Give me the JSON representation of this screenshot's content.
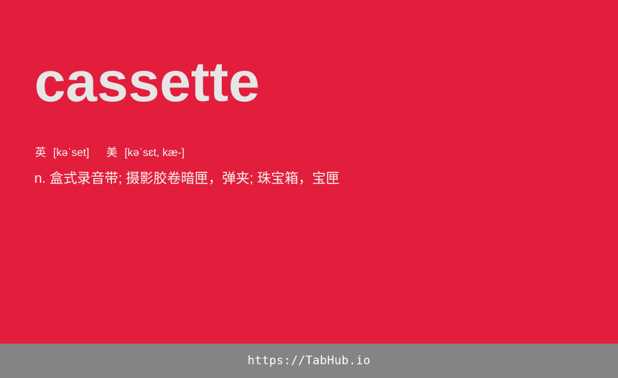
{
  "entry": {
    "word": "cassette",
    "phonetics": {
      "uk_label": "英",
      "uk_ipa": "[kəˈset]",
      "us_label": "美",
      "us_ipa": "[kəˈsɛt, kæ-]"
    },
    "definition": "n. 盒式录音带; 摄影胶卷暗匣，弹夹; 珠宝箱，宝匣"
  },
  "footer": {
    "url": "https://TabHub.io"
  },
  "colors": {
    "background": "#e21e3c",
    "word_text": "#e6e6e6",
    "footer_bg": "#848484",
    "footer_text": "#ffffff"
  }
}
